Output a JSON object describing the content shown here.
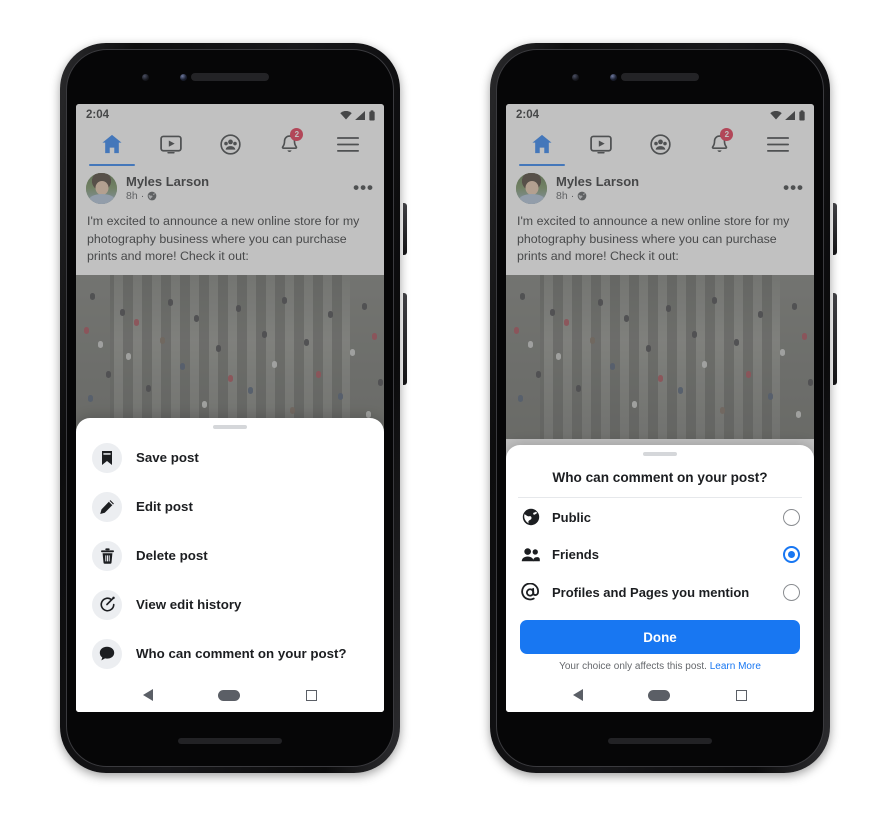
{
  "status_bar": {
    "time": "2:04",
    "wifi_icon": "wifi-icon",
    "signal_icon": "cellular-signal-icon",
    "battery_icon": "battery-icon"
  },
  "top_nav": {
    "tabs": [
      {
        "name": "home",
        "icon": "home-icon",
        "active": true,
        "badge": ""
      },
      {
        "name": "video",
        "icon": "video-icon",
        "active": false,
        "badge": ""
      },
      {
        "name": "groups",
        "icon": "groups-icon",
        "active": false,
        "badge": ""
      },
      {
        "name": "notifications",
        "icon": "bell-icon",
        "active": false,
        "badge": "2"
      },
      {
        "name": "menu",
        "icon": "hamburger-menu-icon",
        "active": false,
        "badge": ""
      }
    ]
  },
  "post": {
    "author": "Myles Larson",
    "time": "8h",
    "separator": "·",
    "audience_icon": "globe-icon",
    "more_icon": "•••",
    "body": "I'm excited to announce a new online store for my photography business where you can purchase prints and more! Check it out:",
    "photo_alt": "aerial-view-of-pedestrian-crosswalk"
  },
  "left_phone": {
    "sheet_menu": [
      {
        "icon": "bookmark-icon",
        "label": "Save post"
      },
      {
        "icon": "pencil-icon",
        "label": "Edit post"
      },
      {
        "icon": "trash-icon",
        "label": "Delete post"
      },
      {
        "icon": "edit-history-icon",
        "label": "View edit history"
      },
      {
        "icon": "comment-icon",
        "label": "Who can comment on your post?"
      }
    ]
  },
  "right_phone": {
    "dialog": {
      "title": "Who can comment on your post?",
      "options": [
        {
          "icon": "globe-icon",
          "label": "Public",
          "selected": false
        },
        {
          "icon": "friends-icon",
          "label": "Friends",
          "selected": true
        },
        {
          "icon": "at-icon",
          "label": "Profiles and Pages you mention",
          "selected": false
        }
      ],
      "done_label": "Done",
      "footer_text": "Your choice only affects this post.",
      "footer_link": "Learn More"
    }
  },
  "android_nav": {
    "back_icon": "back-triangle-icon",
    "home_icon": "home-pill-icon",
    "recents_icon": "recents-square-icon"
  },
  "colors": {
    "facebook_blue": "#1877f2",
    "badge_red": "#e41e3f",
    "text_primary": "#1c1e21",
    "text_secondary": "#65686c",
    "icon_circle": "#eceef1"
  }
}
